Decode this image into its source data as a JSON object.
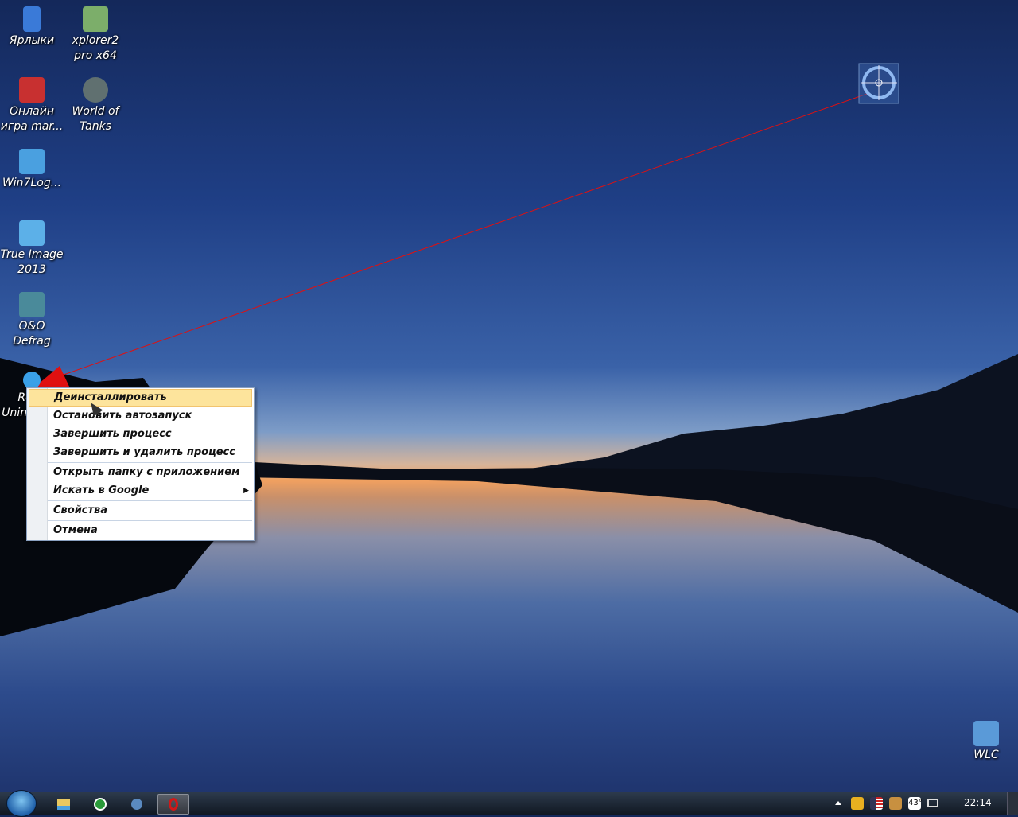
{
  "desktop": {
    "icons": [
      {
        "line1": "Ярлыки",
        "line2": ""
      },
      {
        "line1": "xplorer2",
        "line2": "pro x64"
      },
      {
        "line1": "Онлайн",
        "line2": "игра mar..."
      },
      {
        "line1": "World of",
        "line2": "Tanks"
      },
      {
        "line1": "Win7Log...",
        "line2": ""
      },
      {
        "line1": "True Image",
        "line2": "2013"
      },
      {
        "line1": "O&O",
        "line2": "Defrag"
      },
      {
        "line1": "Revo",
        "line2": "Uninstaller"
      },
      {
        "line1": "WLC",
        "line2": ""
      }
    ]
  },
  "context_menu": {
    "items": [
      {
        "label": "Деинсталлировать"
      },
      {
        "label": "Остановить автозапуск"
      },
      {
        "label": "Завершить процесс"
      },
      {
        "label": "Завершить и удалить процесс"
      },
      {
        "label": "Открыть папку с приложением"
      },
      {
        "label": "Искать в Google",
        "submenu_arrow": "▶"
      },
      {
        "label": "Свойства"
      },
      {
        "label": "Отмена"
      }
    ]
  },
  "taskbar": {
    "clock": "22:14",
    "tray_temp": "43°"
  },
  "colors": {
    "menu_highlight": "#fde49c",
    "pointer_line": "#e01010"
  }
}
